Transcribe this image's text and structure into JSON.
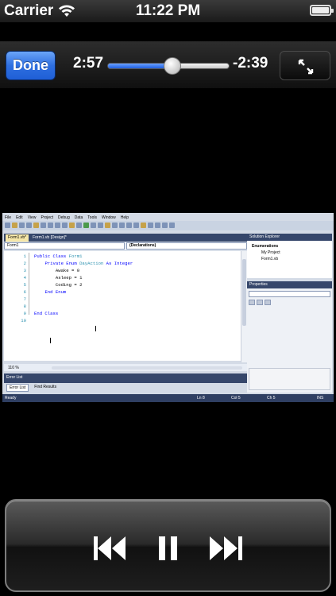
{
  "status_bar": {
    "carrier": "Carrier",
    "time": "11:22 PM",
    "wifi_icon": "wifi-icon",
    "battery_icon": "battery-icon"
  },
  "player": {
    "done_label": "Done",
    "elapsed": "2:57",
    "remaining": "-2:39",
    "progress_fraction": 0.53,
    "accent_color": "#2e6fe0",
    "fullscreen_icon": "fullscreen-toggle-icon"
  },
  "video": {
    "menu": [
      "File",
      "Edit",
      "View",
      "Project",
      "Debug",
      "Data",
      "Tools",
      "Window",
      "Help"
    ],
    "doc_tabs": [
      {
        "label": "Form1.vb*",
        "active": true
      },
      {
        "label": "Form1.vb [Design]*",
        "active": false
      }
    ],
    "class_dropdown": "Form1",
    "member_dropdown": "(Declarations)",
    "code_lines": [
      {
        "num": "1",
        "indent": "",
        "parts": [
          {
            "t": "Public Class ",
            "c": "kw"
          },
          {
            "t": "Form1",
            "c": "tp"
          }
        ]
      },
      {
        "num": "2",
        "indent": "    ",
        "parts": [
          {
            "t": "Private Enum ",
            "c": "kw"
          },
          {
            "t": "DayAction ",
            "c": "tp"
          },
          {
            "t": "As Integer",
            "c": "kw"
          }
        ]
      },
      {
        "num": "3",
        "indent": "        ",
        "parts": [
          {
            "t": "Awake = 0",
            "c": ""
          }
        ]
      },
      {
        "num": "4",
        "indent": "        ",
        "parts": [
          {
            "t": "Asleep = 1",
            "c": ""
          }
        ]
      },
      {
        "num": "5",
        "indent": "        ",
        "parts": [
          {
            "t": "Coding = 2",
            "c": ""
          }
        ]
      },
      {
        "num": "6",
        "indent": "    ",
        "parts": [
          {
            "t": "End Enum",
            "c": "kw"
          }
        ]
      },
      {
        "num": "7",
        "indent": "",
        "parts": []
      },
      {
        "num": "8",
        "indent": "",
        "parts": []
      },
      {
        "num": "9",
        "indent": "",
        "parts": [
          {
            "t": "End Class",
            "c": "kw"
          }
        ]
      },
      {
        "num": "10",
        "indent": "",
        "parts": []
      }
    ],
    "zoom": "110 %",
    "error_list_title": "Error List",
    "error_tabs": [
      "Error List",
      "Find Results"
    ],
    "solution_explorer_title": "Solution Explorer",
    "solution_items": [
      "Enumerations",
      "My Project",
      "Form1.vb"
    ],
    "properties_title": "Properties",
    "status": {
      "ready": "Ready",
      "ln": "Ln 8",
      "col": "Col 5",
      "ch": "Ch 5",
      "ins": "INS"
    }
  },
  "controls": {
    "previous_icon": "skip-previous-icon",
    "pause_icon": "pause-icon",
    "next_icon": "skip-next-icon"
  }
}
